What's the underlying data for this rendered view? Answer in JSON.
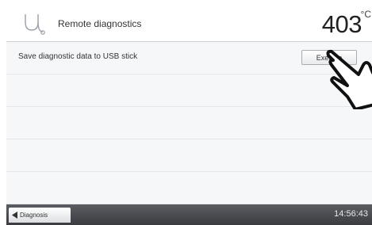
{
  "header": {
    "title": "Remote diagnostics",
    "temperature": "403",
    "temperature_unit": "°C",
    "icon": "stethoscope-icon"
  },
  "rows": [
    {
      "label": "Save diagnostic data to USB stick",
      "button_label": "Execute"
    },
    {
      "label": ""
    },
    {
      "label": ""
    },
    {
      "label": ""
    },
    {
      "label": ""
    }
  ],
  "footer": {
    "back_label": "Diagnosis",
    "time": "14:56:43"
  },
  "colors": {
    "footer_bar": "#45484c",
    "row_background": "#f6f7f8"
  }
}
